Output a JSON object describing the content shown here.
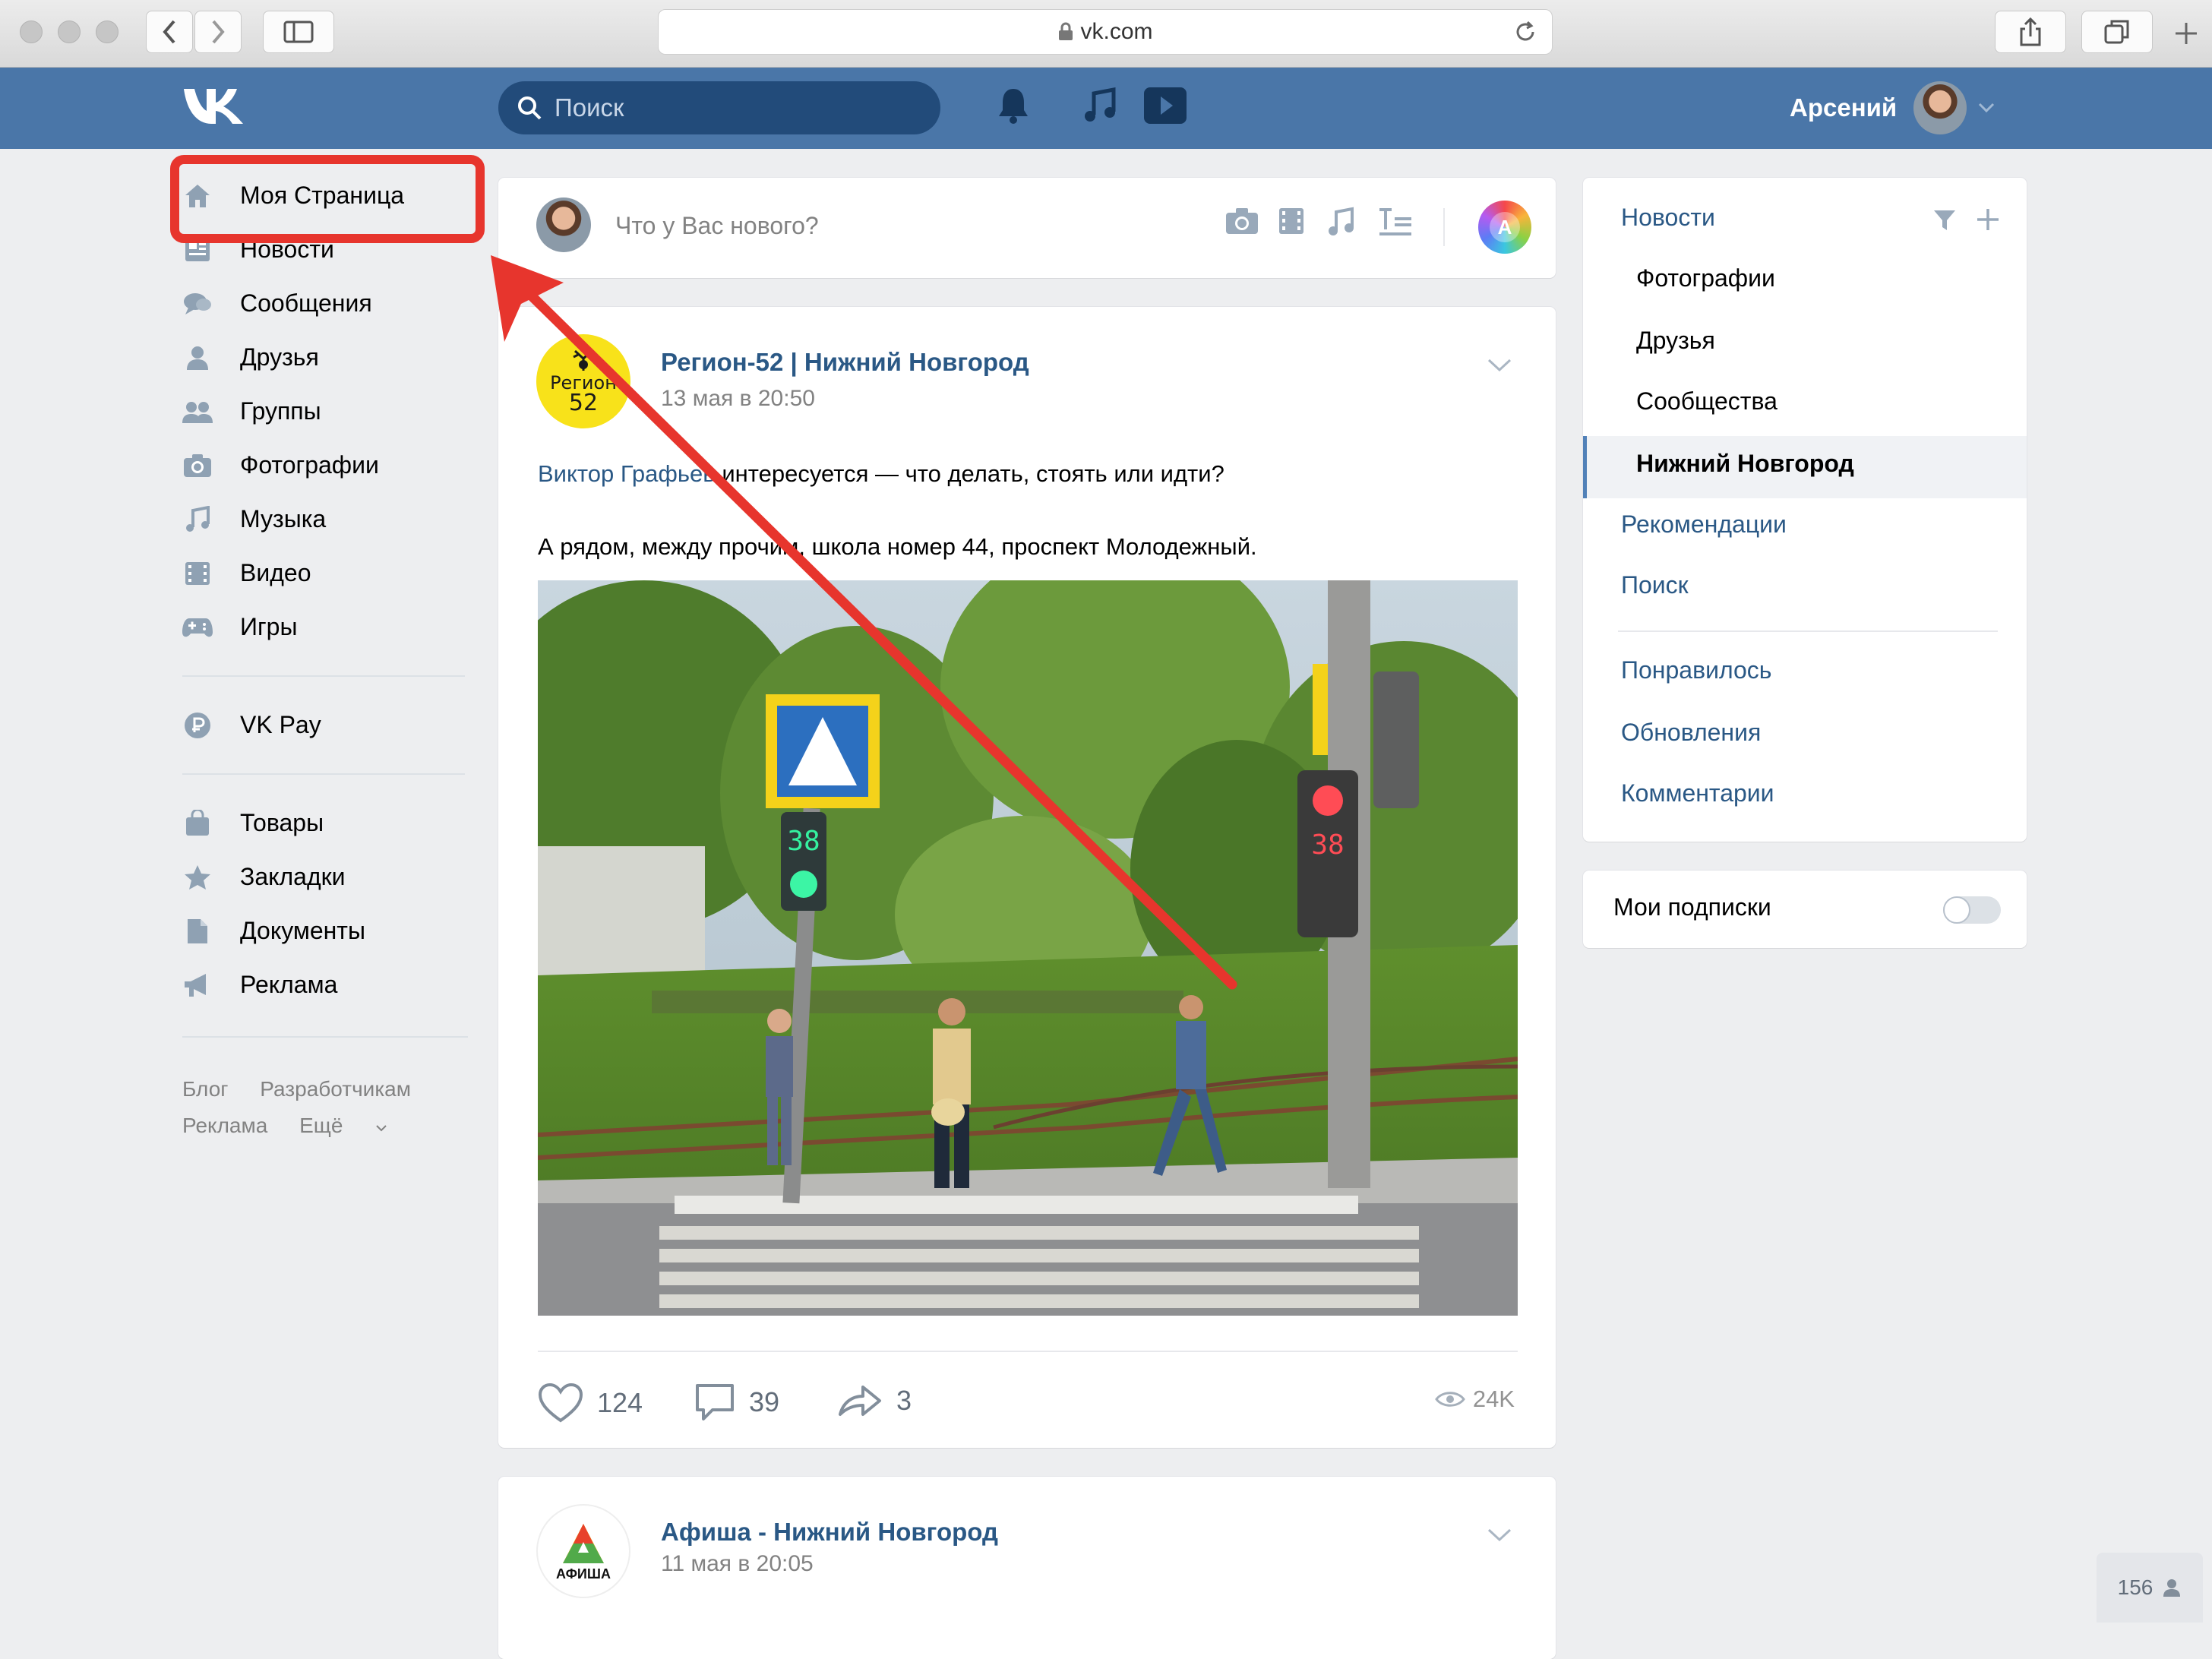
{
  "browser": {
    "url": "vk.com"
  },
  "header": {
    "search_placeholder": "Поиск",
    "user_name": "Арсений",
    "brand_color": "#4a76a8"
  },
  "left_nav": {
    "items": [
      {
        "label": "Моя Страница",
        "icon": "home-icon"
      },
      {
        "label": "Новости",
        "icon": "news-icon"
      },
      {
        "label": "Сообщения",
        "icon": "messages-icon"
      },
      {
        "label": "Друзья",
        "icon": "friends-icon"
      },
      {
        "label": "Группы",
        "icon": "groups-icon"
      },
      {
        "label": "Фотографии",
        "icon": "camera-icon"
      },
      {
        "label": "Музыка",
        "icon": "music-icon"
      },
      {
        "label": "Видео",
        "icon": "video-icon"
      },
      {
        "label": "Игры",
        "icon": "gamepad-icon"
      },
      {
        "label": "VK Pay",
        "icon": "vkpay-icon"
      },
      {
        "label": "Товары",
        "icon": "bag-icon"
      },
      {
        "label": "Закладки",
        "icon": "star-icon"
      },
      {
        "label": "Документы",
        "icon": "document-icon"
      },
      {
        "label": "Реклама",
        "icon": "megaphone-icon"
      }
    ],
    "footer": [
      "Блог",
      "Разработчикам",
      "Реклама",
      "Ещё"
    ],
    "highlight_color": "#e7352d"
  },
  "composer": {
    "placeholder": "Что у Вас нового?",
    "aa_label": "A"
  },
  "posts": [
    {
      "author": "Регион-52 | Нижний Новгород",
      "date": "13 мая в 20:50",
      "avatar_text": [
        "Регион",
        "52"
      ],
      "mention": "Виктор Графьев",
      "text_line1": " интересуется — что делать, стоять или идти?",
      "text_line2": "А рядом, между прочим, школа номер 44, проспект Молодежный.",
      "photo_numbers": [
        "38",
        "38"
      ],
      "likes": "124",
      "comments": "39",
      "shares": "3",
      "views": "24K"
    },
    {
      "author": "Афиша - Нижний Новгород",
      "date": "11 мая в 20:05",
      "avatar_text": "АФИША"
    }
  ],
  "feed_menu": {
    "title": "Новости",
    "sub_items": [
      "Фотографии",
      "Друзья",
      "Сообщества",
      "Нижний Новгород"
    ],
    "items": [
      "Рекомендации",
      "Поиск"
    ],
    "items2": [
      "Понравилось",
      "Обновления",
      "Комментарии"
    ]
  },
  "subscriptions": {
    "label": "Мои подписки",
    "enabled": false
  },
  "chat": {
    "online_count": "156"
  }
}
